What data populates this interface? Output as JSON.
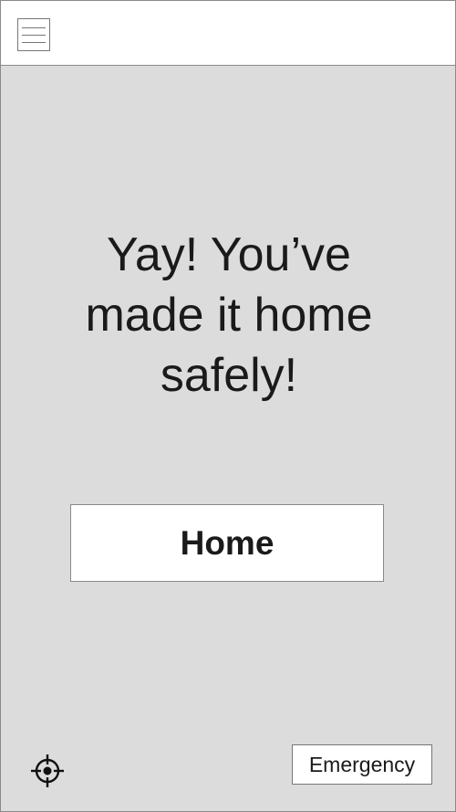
{
  "header": {
    "menu_icon": "hamburger-menu-icon"
  },
  "main": {
    "message": "Yay! You’ve made it home safely!",
    "home_button_label": "Home",
    "locate_icon": "crosshair-icon",
    "emergency_button_label": "Emergency"
  },
  "colors": {
    "background": "#dcdcdc",
    "surface": "#ffffff",
    "text": "#1a1a1a",
    "border": "#8a8a8a"
  }
}
